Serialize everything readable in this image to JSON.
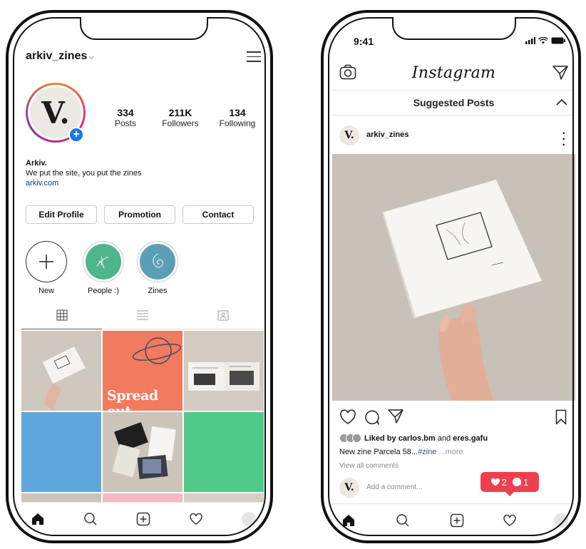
{
  "profile_screen": {
    "username": "arkiv_zines",
    "chevron": "⌵",
    "menu_icon": "hamburger-icon",
    "avatar_letter": "V.",
    "stats": [
      {
        "value": "334",
        "label": "Posts"
      },
      {
        "value": "211K",
        "label": "Followers"
      },
      {
        "value": "134",
        "label": "Following"
      }
    ],
    "bio": {
      "name": "Arkiv.",
      "text": "We put the site, you put the zines",
      "link": "arkiv.com"
    },
    "buttons": {
      "edit_profile": "Edit Profile",
      "promotion": "Promotion",
      "contact": "Contact"
    },
    "highlights": [
      {
        "label": "New"
      },
      {
        "label": "People :)"
      },
      {
        "label": "Zines"
      }
    ],
    "grid_tile_text": "Spread out",
    "colors": {
      "accent_blue": "#1877f2",
      "tile_coral": "#f27a5e",
      "tile_blue": "#5fa8dc",
      "tile_green": "#4fca88",
      "tile_pink": "#f6b9c1",
      "highlight_green": "#4fb58a",
      "highlight_teal": "#5b9fb7"
    }
  },
  "feed_screen": {
    "time": "9:41",
    "app_title": "Instagram",
    "section_title": "Suggested Posts",
    "post": {
      "avatar_letter": "V.",
      "username": "arkiv_zines",
      "liked_by_prefix": "Liked by",
      "liked_by_user": "carlos.bm",
      "liked_and": "and",
      "liked_other": "eres.gafu",
      "caption_text": "New zine Parcela 58...",
      "caption_tag": "#zine",
      "caption_more": " ...more",
      "view_all": "View all comments",
      "comment_placeholder": "Add a comment..."
    },
    "notification": {
      "likes": "2",
      "comments": "1",
      "color": "#ef3f4f"
    }
  }
}
